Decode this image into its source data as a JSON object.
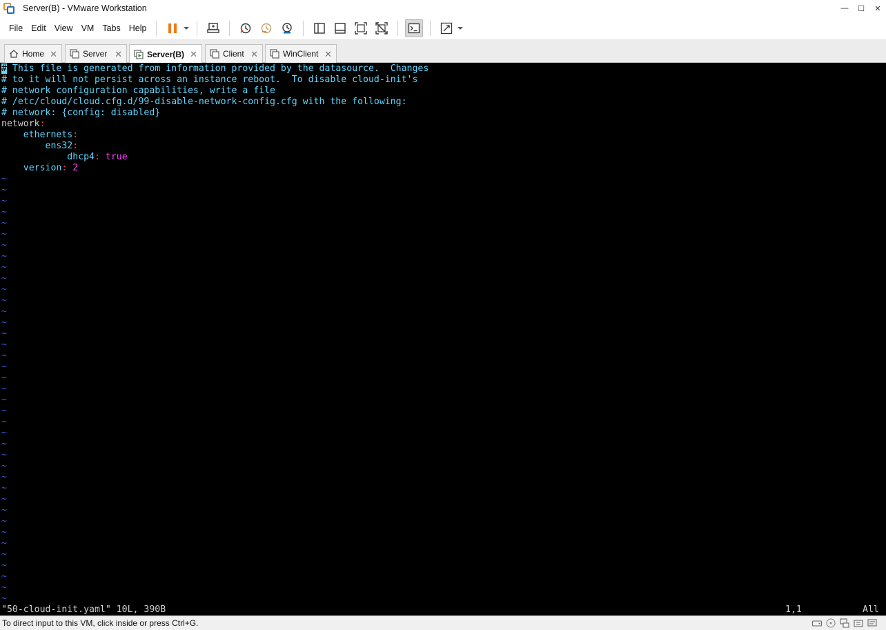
{
  "window": {
    "title": "Server(B) - VMware Workstation",
    "minimize_glyph": "—",
    "maximize_glyph": "☐",
    "close_glyph": "✕"
  },
  "menu": {
    "items": [
      "File",
      "Edit",
      "View",
      "VM",
      "Tabs",
      "Help"
    ]
  },
  "toolbar": {
    "icons": [
      "pause-icon",
      "send-keys-icon",
      "snapshot-icon",
      "revert-snapshot-icon",
      "snapshot-manager-icon",
      "library-icon",
      "thumbnail-icon",
      "fullscreen-icon",
      "unity-icon",
      "console-view-icon",
      "stretch-icon"
    ]
  },
  "tabs": [
    {
      "label": "Home",
      "icon": "home-icon",
      "active": false
    },
    {
      "label": "Server",
      "icon": "vm-icon",
      "active": false
    },
    {
      "label": "Server(B)",
      "icon": "vm-running-icon",
      "active": true
    },
    {
      "label": "Client",
      "icon": "vm-icon",
      "active": false
    },
    {
      "label": "WinClient",
      "icon": "vm-icon",
      "active": false
    }
  ],
  "console": {
    "lines": [
      "# This file is generated from information provided by the datasource.  Changes",
      "# to it will not persist across an instance reboot.  To disable cloud-init's",
      "# network configuration capabilities, write a file",
      "# /etc/cloud/cloud.cfg.d/99-disable-network-config.cfg with the following:",
      "# network: {config: disabled}"
    ],
    "yaml": {
      "network_key": "network",
      "ethernets_key": "ethernets",
      "iface_key": "ens32",
      "dhcp_key": "dhcp4",
      "dhcp_value": "true",
      "version_key": "version",
      "version_value": "2",
      "colon": ":"
    },
    "tilde": "~",
    "file_info": "\"50-cloud-init.yaml\" 10L, 390B",
    "position": "1,1",
    "scroll": "All"
  },
  "statusbar": {
    "message": "To direct input to this VM, click inside or press Ctrl+G."
  },
  "colors": {
    "comment": "#5fd7ff",
    "key": "#ff3b3b",
    "value": "#ff40ff",
    "tilde": "#3a5fe0",
    "accent_pause": "#f07a1a"
  }
}
